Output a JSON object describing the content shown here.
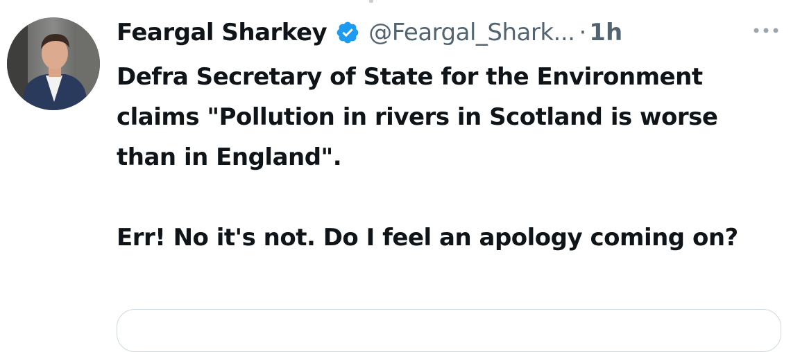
{
  "tweet": {
    "author_name": "Feargal Sharkey",
    "handle": "@Feargal_Shark...",
    "separator": "·",
    "time": "1h",
    "text_paragraphs": [
      "Defra Secretary of State for the Environment claims \"Pollution in rivers in Scotland is worse than in England\".",
      "Err! No it's not. Do I feel an apology coming on?"
    ]
  },
  "icons": {
    "verified": "verified-badge-icon",
    "more": "more-options-icon"
  },
  "colors": {
    "text_primary": "#0f1419",
    "text_secondary": "#536471",
    "verified_blue": "#1d9bf0",
    "card_border": "#cfd9de"
  }
}
